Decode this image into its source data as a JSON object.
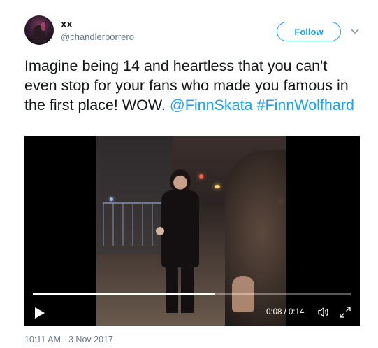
{
  "user": {
    "display_name": "xx",
    "handle": "@chandlerborrero"
  },
  "follow_button": {
    "label": "Follow"
  },
  "tweet": {
    "text_plain": "Imagine being 14 and heartless that you can't even stop for your fans who made you famous in the first place! WOW. ",
    "mention": "@FinnSkata",
    "hashtag": "#FinnWolfhard"
  },
  "video": {
    "elapsed": "0:08",
    "duration": "0:14",
    "time_label": "0:08 / 0:14",
    "progress_fraction": 0.57
  },
  "timestamp": "10:11 AM - 3 Nov 2017",
  "colors": {
    "accent": "#1da1f2",
    "muted": "#657786",
    "text": "#14171a"
  },
  "icons": {
    "caret": "chevron-down-icon",
    "play": "play-icon",
    "volume": "volume-icon",
    "fullscreen": "fullscreen-icon"
  }
}
